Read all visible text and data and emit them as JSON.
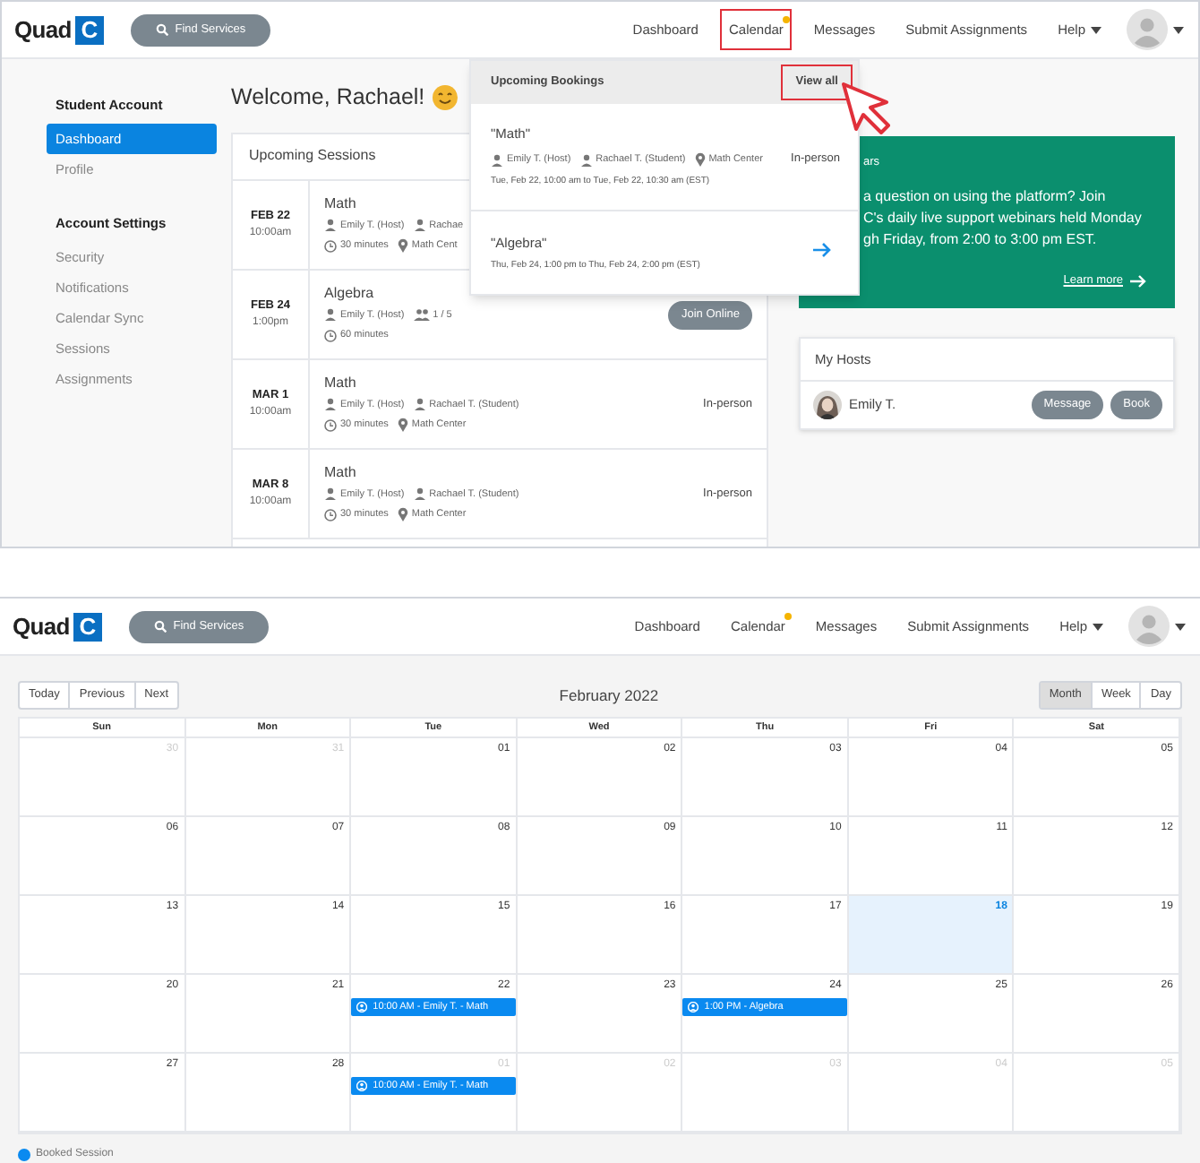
{
  "top_screen": {
    "header": {
      "logo": {
        "text": "Quad",
        "mark": "C"
      },
      "search_button": "Find Services",
      "nav": [
        {
          "label": "Dashboard",
          "notification": false,
          "annotated": false,
          "dropdown": false
        },
        {
          "label": "Calendar",
          "notification": true,
          "annotated": true,
          "dropdown": false
        },
        {
          "label": "Messages",
          "notification": false,
          "annotated": false,
          "dropdown": false
        },
        {
          "label": "Submit Assignments",
          "notification": false,
          "annotated": false,
          "dropdown": false
        },
        {
          "label": "Help",
          "notification": false,
          "annotated": false,
          "dropdown": true
        }
      ]
    },
    "sidebar": [
      {
        "heading": "Student Account",
        "items": [
          {
            "label": "Dashboard",
            "selected": true
          },
          {
            "label": "Profile",
            "selected": false
          }
        ]
      },
      {
        "heading": "Account Settings",
        "items": [
          {
            "label": "Security",
            "selected": false
          },
          {
            "label": "Notifications",
            "selected": false
          },
          {
            "label": "Calendar Sync",
            "selected": false
          },
          {
            "label": "Sessions",
            "selected": false
          },
          {
            "label": "Assignments",
            "selected": false
          }
        ]
      }
    ],
    "welcome": "Welcome, Rachael!",
    "sessions": {
      "title": "Upcoming Sessions",
      "rows": [
        {
          "date": "FEB 22",
          "time": "10:00am",
          "subject": "Math",
          "meta1": [
            {
              "kind": "person",
              "text": "Emily T. (Host)"
            },
            {
              "kind": "person",
              "text": "Rachae"
            }
          ],
          "meta2": [
            {
              "kind": "clock",
              "text": "30 minutes"
            },
            {
              "kind": "pin",
              "text": "Math Cent"
            }
          ]
        },
        {
          "date": "FEB 24",
          "time": "1:00pm",
          "subject": "Algebra",
          "meta1": [
            {
              "kind": "person",
              "text": "Emily T. (Host)"
            },
            {
              "kind": "group",
              "text": "1 / 5"
            }
          ],
          "meta2": [
            {
              "kind": "clock",
              "text": "60 minutes"
            }
          ],
          "action": {
            "kind": "button",
            "text": "Join Online"
          }
        },
        {
          "date": "MAR 1",
          "time": "10:00am",
          "subject": "Math",
          "meta1": [
            {
              "kind": "person",
              "text": "Emily T. (Host)"
            },
            {
              "kind": "person",
              "text": "Rachael T. (Student)"
            }
          ],
          "meta2": [
            {
              "kind": "clock",
              "text": "30 minutes"
            },
            {
              "kind": "pin",
              "text": "Math Center"
            }
          ],
          "action": {
            "kind": "label",
            "text": "In-person"
          }
        },
        {
          "date": "MAR 8",
          "time": "10:00am",
          "subject": "Math",
          "meta1": [
            {
              "kind": "person",
              "text": "Emily T. (Host)"
            },
            {
              "kind": "person",
              "text": "Rachael T. (Student)"
            }
          ],
          "meta2": [
            {
              "kind": "clock",
              "text": "30 minutes"
            },
            {
              "kind": "pin",
              "text": "Math Center"
            }
          ],
          "action": {
            "kind": "label",
            "text": "In-person"
          }
        }
      ]
    },
    "bookings_dropdown": {
      "title": "Upcoming Bookings",
      "view_all": {
        "label": "View all",
        "annotated": true
      },
      "items": [
        {
          "title": "\"Math\"",
          "meta": [
            {
              "kind": "person",
              "text": "Emily T. (Host)"
            },
            {
              "kind": "person",
              "text": "Rachael T. (Student)"
            },
            {
              "kind": "pin",
              "text": "Math Center"
            }
          ],
          "mode": "In-person",
          "when": "Tue, Feb 22, 10:00 am to Tue, Feb 22, 10:30 am (EST)",
          "arrow": false
        },
        {
          "title": "\"Algebra\"",
          "when": "Thu, Feb 24, 1:00 pm to Thu, Feb 24, 2:00 pm (EST)",
          "arrow": true
        }
      ]
    },
    "webinar_card": {
      "title": "ars",
      "lines": [
        "a question on using the platform? Join",
        "C's daily live support webinars held Monday",
        "gh Friday, from 2:00 to 3:00 pm EST."
      ],
      "link": "Learn more"
    },
    "hosts": {
      "title": "My Hosts",
      "items": [
        {
          "name": "Emily T.",
          "buttons": [
            "Message",
            "Book"
          ]
        }
      ]
    }
  },
  "bottom_screen": {
    "header": {
      "logo": {
        "text": "Quad",
        "mark": "C"
      },
      "search_button": "Find Services",
      "nav": [
        {
          "label": "Dashboard",
          "notification": false,
          "dropdown": false
        },
        {
          "label": "Calendar",
          "notification": true,
          "dropdown": false
        },
        {
          "label": "Messages",
          "notification": false,
          "dropdown": false
        },
        {
          "label": "Submit Assignments",
          "notification": false,
          "dropdown": false
        },
        {
          "label": "Help",
          "notification": false,
          "dropdown": true
        }
      ]
    },
    "nav_buttons": [
      "Today",
      "Previous",
      "Next"
    ],
    "month_title": "February 2022",
    "views": [
      {
        "label": "Month",
        "selected": true
      },
      {
        "label": "Week",
        "selected": false
      },
      {
        "label": "Day",
        "selected": false
      }
    ],
    "weekdays": [
      "Sun",
      "Mon",
      "Tue",
      "Wed",
      "Thu",
      "Fri",
      "Sat"
    ],
    "weeks": [
      [
        {
          "day": "30",
          "in_month": false
        },
        {
          "day": "31",
          "in_month": false
        },
        {
          "day": "01",
          "in_month": true
        },
        {
          "day": "02",
          "in_month": true
        },
        {
          "day": "03",
          "in_month": true
        },
        {
          "day": "04",
          "in_month": true
        },
        {
          "day": "05",
          "in_month": true
        }
      ],
      [
        {
          "day": "06",
          "in_month": true
        },
        {
          "day": "07",
          "in_month": true
        },
        {
          "day": "08",
          "in_month": true
        },
        {
          "day": "09",
          "in_month": true
        },
        {
          "day": "10",
          "in_month": true
        },
        {
          "day": "11",
          "in_month": true
        },
        {
          "day": "12",
          "in_month": true
        }
      ],
      [
        {
          "day": "13",
          "in_month": true
        },
        {
          "day": "14",
          "in_month": true
        },
        {
          "day": "15",
          "in_month": true
        },
        {
          "day": "16",
          "in_month": true
        },
        {
          "day": "17",
          "in_month": true
        },
        {
          "day": "18",
          "in_month": true,
          "today": true
        },
        {
          "day": "19",
          "in_month": true
        }
      ],
      [
        {
          "day": "20",
          "in_month": true
        },
        {
          "day": "21",
          "in_month": true
        },
        {
          "day": "22",
          "in_month": true,
          "events": [
            "10:00 AM - Emily T. - Math"
          ]
        },
        {
          "day": "23",
          "in_month": true
        },
        {
          "day": "24",
          "in_month": true,
          "events": [
            "1:00 PM - Algebra"
          ]
        },
        {
          "day": "25",
          "in_month": true
        },
        {
          "day": "26",
          "in_month": true
        }
      ],
      [
        {
          "day": "27",
          "in_month": true
        },
        {
          "day": "28",
          "in_month": true
        },
        {
          "day": "01",
          "in_month": false,
          "events": [
            "10:00 AM - Emily T. - Math"
          ]
        },
        {
          "day": "02",
          "in_month": false
        },
        {
          "day": "03",
          "in_month": false
        },
        {
          "day": "04",
          "in_month": false
        },
        {
          "day": "05",
          "in_month": false
        }
      ]
    ],
    "legend": [
      {
        "label": "Booked Session",
        "color": "#0a8af0"
      }
    ]
  }
}
